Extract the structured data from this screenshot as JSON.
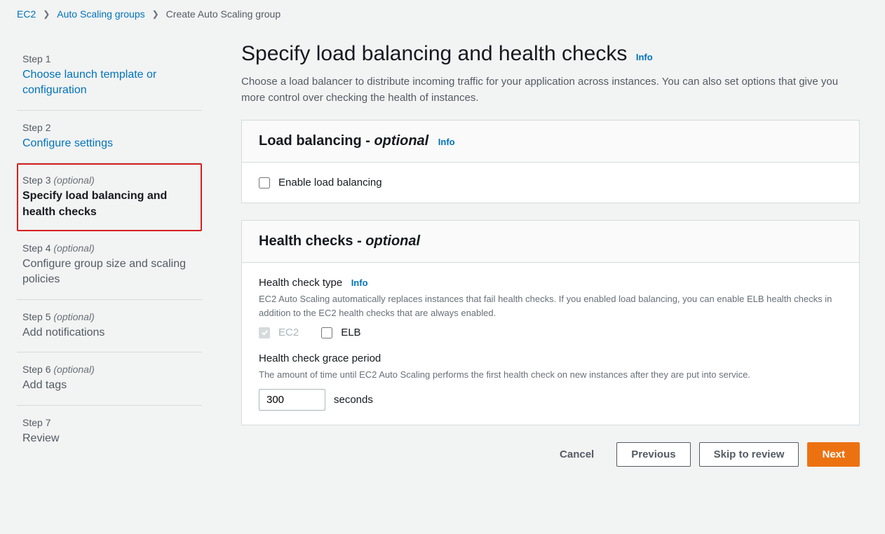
{
  "breadcrumb": {
    "items": [
      "EC2",
      "Auto Scaling groups"
    ],
    "current": "Create Auto Scaling group"
  },
  "sidebar": {
    "steps": [
      {
        "label": "Step 1",
        "optional": "",
        "title": "Choose launch template or configuration",
        "style": "link"
      },
      {
        "label": "Step 2",
        "optional": "",
        "title": "Configure settings",
        "style": "link"
      },
      {
        "label": "Step 3",
        "optional": "(optional)",
        "title": "Specify load balancing and health checks",
        "style": "active"
      },
      {
        "label": "Step 4",
        "optional": "(optional)",
        "title": "Configure group size and scaling policies",
        "style": "muted"
      },
      {
        "label": "Step 5",
        "optional": "(optional)",
        "title": "Add notifications",
        "style": "muted"
      },
      {
        "label": "Step 6",
        "optional": "(optional)",
        "title": "Add tags",
        "style": "muted"
      },
      {
        "label": "Step 7",
        "optional": "",
        "title": "Review",
        "style": "muted"
      }
    ]
  },
  "header": {
    "title": "Specify load balancing and health checks",
    "info": "Info",
    "description": "Choose a load balancer to distribute incoming traffic for your application across instances. You can also set options that give you more control over checking the health of instances."
  },
  "load_balancing": {
    "title_main": "Load balancing -",
    "title_optional": "optional",
    "info": "Info",
    "enable_label": "Enable load balancing"
  },
  "health_checks": {
    "title_main": "Health checks -",
    "title_optional": "optional",
    "type_label": "Health check type",
    "type_info": "Info",
    "type_desc": "EC2 Auto Scaling automatically replaces instances that fail health checks. If you enabled load balancing, you can enable ELB health checks in addition to the EC2 health checks that are always enabled.",
    "ec2_label": "EC2",
    "elb_label": "ELB",
    "grace_label": "Health check grace period",
    "grace_desc": "The amount of time until EC2 Auto Scaling performs the first health check on new instances after they are put into service.",
    "grace_value": "300",
    "grace_unit": "seconds"
  },
  "footer": {
    "cancel": "Cancel",
    "previous": "Previous",
    "skip": "Skip to review",
    "next": "Next"
  }
}
